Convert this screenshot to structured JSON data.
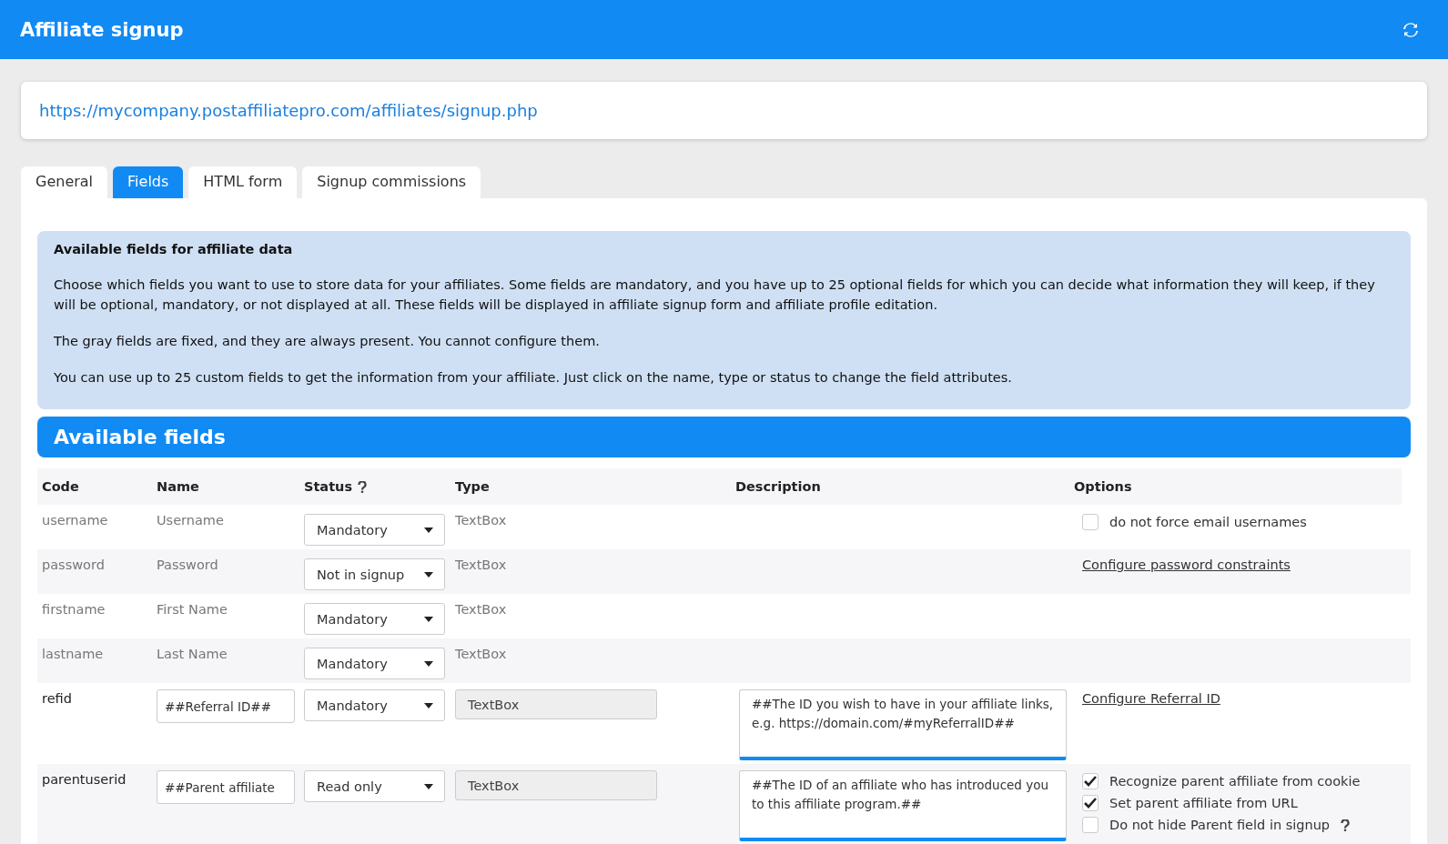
{
  "header": {
    "title": "Affiliate signup"
  },
  "signup_url": "https://mycompany.postaffiliatepro.com/affiliates/signup.php",
  "tabs": [
    {
      "label": "General",
      "selected": false
    },
    {
      "label": "Fields",
      "selected": true
    },
    {
      "label": "HTML form",
      "selected": false
    },
    {
      "label": "Signup commissions",
      "selected": false
    }
  ],
  "info": {
    "title": "Available fields for affiliate data",
    "paragraphs": [
      "Choose which fields you want to use to store data for your affiliates. Some fields are mandatory, and you have up to 25 optional fields for which you can decide what information they will keep, if they will be optional, mandatory, or not displayed at all. These fields will be displayed in affiliate signup form and affiliate profile editation.",
      "The gray fields are fixed, and they are always present. You cannot configure them.",
      "You can use up to 25 custom fields to get the information from your affiliate. Just click on the name, type or status to change the field attributes."
    ]
  },
  "section_title": "Available fields",
  "table": {
    "columns": [
      "Code",
      "Name",
      "Status",
      "Type",
      "Description",
      "Options"
    ],
    "rows": [
      {
        "kind": "fixed",
        "code": "username",
        "name": "Username",
        "status": "Mandatory",
        "type": "TextBox",
        "options": [
          {
            "kind": "checkbox",
            "label": "do not force email usernames",
            "checked": false
          }
        ]
      },
      {
        "kind": "fixed",
        "code": "password",
        "name": "Password",
        "status": "Not in signup",
        "type": "TextBox",
        "options": [
          {
            "kind": "link",
            "label": "Configure password constraints"
          }
        ]
      },
      {
        "kind": "fixed",
        "code": "firstname",
        "name": "First Name",
        "status": "Mandatory",
        "type": "TextBox",
        "options": []
      },
      {
        "kind": "fixed",
        "code": "lastname",
        "name": "Last Name",
        "status": "Mandatory",
        "type": "TextBox",
        "options": []
      },
      {
        "kind": "custom",
        "code": "refid",
        "name": "##Referral ID##",
        "status": "Mandatory",
        "type": "TextBox",
        "description": "##The ID you wish to have in your affiliate links, e.g. https://domain.com/#myReferralID##",
        "options": [
          {
            "kind": "link",
            "label": "Configure Referral ID"
          }
        ]
      },
      {
        "kind": "custom",
        "code": "parentuserid",
        "name": "##Parent affiliate",
        "status": "Read only",
        "type": "TextBox",
        "description": "##The ID of an affiliate who has introduced you to this affiliate program.##",
        "options": [
          {
            "kind": "checkbox",
            "label": "Recognize parent affiliate from cookie",
            "checked": true
          },
          {
            "kind": "checkbox",
            "label": "Set parent affiliate from URL",
            "checked": true
          },
          {
            "kind": "checkbox",
            "label": "Do not hide Parent field in signup",
            "checked": false,
            "help": true
          }
        ]
      }
    ]
  }
}
